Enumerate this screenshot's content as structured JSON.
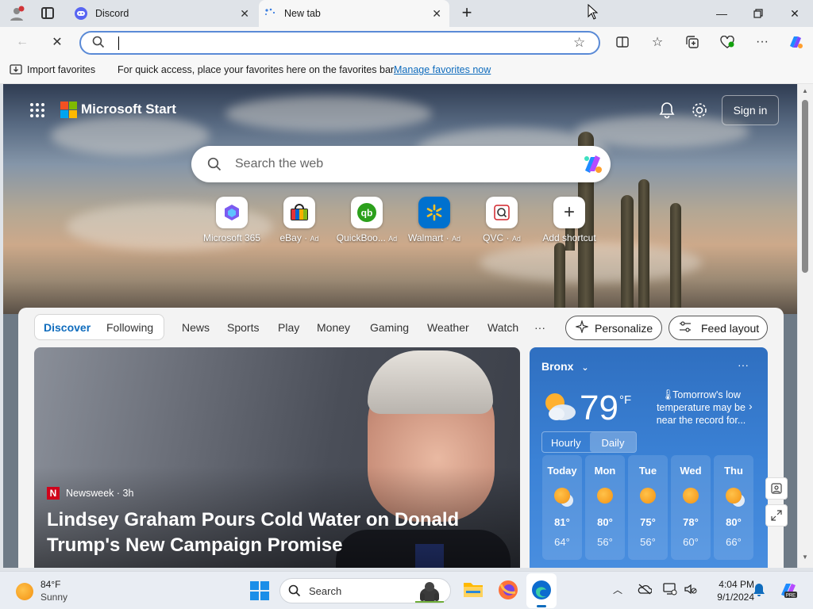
{
  "browser": {
    "tabs": [
      {
        "title": "Discord",
        "active": false
      },
      {
        "title": "New tab",
        "active": true
      }
    ],
    "address_value": "",
    "favorites_bar": {
      "import_label": "Import favorites",
      "message": "For quick access, place your favorites here on the favorites bar.",
      "manage_link": "Manage favorites now"
    }
  },
  "start": {
    "brand": "Microsoft Start",
    "sign_in": "Sign in",
    "search_placeholder": "Search the web",
    "shortcuts": [
      {
        "label": "Microsoft 365",
        "ad": ""
      },
      {
        "label": "eBay",
        "ad": "Ad"
      },
      {
        "label": "QuickBoo...",
        "ad": "Ad"
      },
      {
        "label": "Walmart",
        "ad": "Ad"
      },
      {
        "label": "QVC",
        "ad": "Ad"
      },
      {
        "label": "Add shortcut",
        "ad": ""
      }
    ]
  },
  "feed": {
    "tabs": [
      "Discover",
      "Following",
      "News",
      "Sports",
      "Play",
      "Money",
      "Gaming",
      "Weather",
      "Watch"
    ],
    "more": "···",
    "personalize": "Personalize",
    "feed_layout": "Feed layout",
    "headline": {
      "source": "Newsweek · 3h",
      "title": "Lindsey Graham Pours Cold Water on Donald Trump's New Campaign Promise"
    }
  },
  "weather": {
    "location": "Bronx",
    "temp": "79",
    "unit": "°F",
    "note": "Tomorrow's low temperature may be near the record for...",
    "toggle": [
      "Hourly",
      "Daily"
    ],
    "days": [
      {
        "name": "Today",
        "hi": "81°",
        "lo": "64°"
      },
      {
        "name": "Mon",
        "hi": "80°",
        "lo": "56°"
      },
      {
        "name": "Tue",
        "hi": "75°",
        "lo": "56°"
      },
      {
        "name": "Wed",
        "hi": "78°",
        "lo": "60°"
      },
      {
        "name": "Thu",
        "hi": "80°",
        "lo": "66°"
      }
    ]
  },
  "taskbar": {
    "weather_temp": "84°F",
    "weather_cond": "Sunny",
    "search": "Search",
    "time": "4:04 PM",
    "date": "9/1/2024"
  },
  "colors": {
    "accent": "#0f6cbd",
    "weather_bg": "#3b82d6"
  }
}
